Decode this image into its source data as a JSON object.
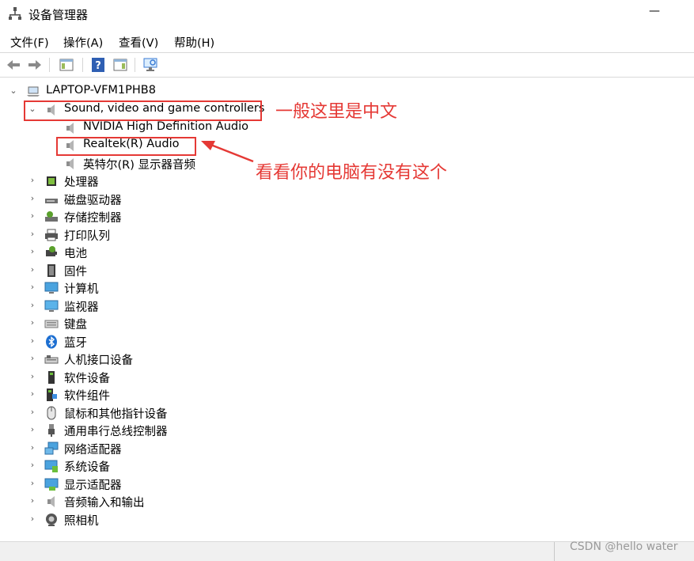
{
  "window": {
    "title": "设备管理器",
    "minimize_glyph": "—"
  },
  "menu": [
    "文件(F)",
    "操作(A)",
    "查看(V)",
    "帮助(H)"
  ],
  "toolbar": {
    "buttons": [
      "back-arrow-icon",
      "forward-arrow-icon",
      "show-hide-console-tree-icon",
      "help-icon",
      "properties-icon",
      "scan-hardware-icon"
    ]
  },
  "tree": {
    "root": {
      "label": "LAPTOP-VFM1PHB8",
      "expanded": true
    },
    "expanded_category": {
      "label": "Sound, video and game controllers",
      "children": [
        "NVIDIA High Definition Audio",
        "Realtek(R) Audio",
        "英特尔(R) 显示器音频"
      ]
    },
    "categories": [
      {
        "label": "处理器",
        "icon": "processor-icon"
      },
      {
        "label": "磁盘驱动器",
        "icon": "disk-drive-icon"
      },
      {
        "label": "存储控制器",
        "icon": "storage-controller-icon"
      },
      {
        "label": "打印队列",
        "icon": "printer-icon"
      },
      {
        "label": "电池",
        "icon": "battery-icon"
      },
      {
        "label": "固件",
        "icon": "firmware-icon"
      },
      {
        "label": "计算机",
        "icon": "computer-icon"
      },
      {
        "label": "监视器",
        "icon": "monitor-icon"
      },
      {
        "label": "键盘",
        "icon": "keyboard-icon"
      },
      {
        "label": "蓝牙",
        "icon": "bluetooth-icon"
      },
      {
        "label": "人机接口设备",
        "icon": "hid-icon"
      },
      {
        "label": "软件设备",
        "icon": "software-device-icon"
      },
      {
        "label": "软件组件",
        "icon": "software-component-icon"
      },
      {
        "label": "鼠标和其他指针设备",
        "icon": "mouse-icon"
      },
      {
        "label": "通用串行总线控制器",
        "icon": "usb-icon"
      },
      {
        "label": "网络适配器",
        "icon": "network-adapter-icon"
      },
      {
        "label": "系统设备",
        "icon": "system-device-icon"
      },
      {
        "label": "显示适配器",
        "icon": "display-adapter-icon"
      },
      {
        "label": "音频输入和输出",
        "icon": "audio-io-icon"
      },
      {
        "label": "照相机",
        "icon": "camera-icon"
      }
    ]
  },
  "annotations": {
    "note_top": "一般这里是中文",
    "note_arrow": "看看你的电脑有没有这个"
  },
  "watermark": "CSDN @hello water",
  "colors": {
    "annotation_red": "#e53935",
    "selection": "#cce8ff"
  }
}
